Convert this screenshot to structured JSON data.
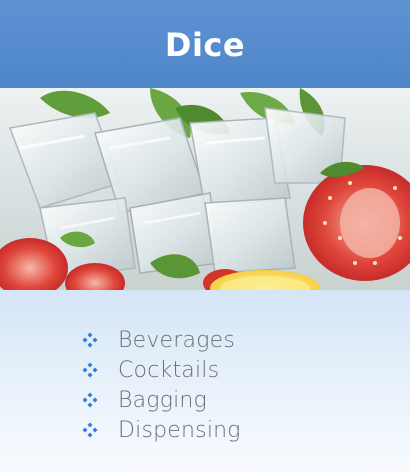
{
  "card": {
    "title": "Dice",
    "photo_subject": "ice cubes with mint, strawberries and lemon",
    "features": [
      {
        "label": "Beverages",
        "icon": "diamond-bullet-icon"
      },
      {
        "label": "Cocktails",
        "icon": "diamond-bullet-icon"
      },
      {
        "label": "Bagging",
        "icon": "diamond-bullet-icon"
      },
      {
        "label": "Dispensing",
        "icon": "diamond-bullet-icon"
      }
    ]
  },
  "colors": {
    "header": "#5289cc",
    "title_text": "#ffffff",
    "bullet": "#2f7fd0",
    "feature_text": "#6d6e71",
    "panel_top": "#d4e5f7",
    "panel_bottom": "#f7fbff"
  }
}
